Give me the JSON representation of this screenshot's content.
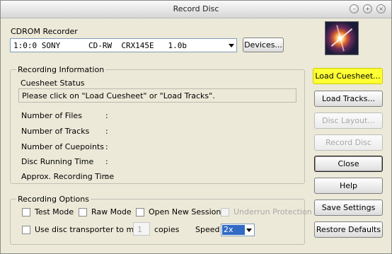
{
  "window": {
    "title": "Record Disc"
  },
  "recorder": {
    "label": "CDROM Recorder",
    "selected": "1:0:0 SONY      CD-RW  CRX145E   1.0b",
    "devices_button": "Devices..."
  },
  "info": {
    "group_label": "Recording Information",
    "cuesheet_status_label": "Cuesheet Status",
    "cuesheet_status_text": "Please click on \"Load Cuesheet\" or \"Load Tracks\".",
    "rows": [
      {
        "label": "Number of Files",
        "value": ":"
      },
      {
        "label": "Number of Tracks",
        "value": ":"
      },
      {
        "label": "Number of Cuepoints",
        "value": ":"
      },
      {
        "label": "Disc Running Time",
        "value": ":"
      },
      {
        "label": "Approx. Recording Time",
        "value": ":"
      }
    ]
  },
  "options": {
    "group_label": "Recording Options",
    "test_mode": "Test Mode",
    "raw_mode": "Raw Mode",
    "open_new_session": "Open New Session",
    "underrun_protection": "Underrun Protection",
    "transporter_label": "Use disc transporter to make",
    "copies_value": "1",
    "copies_label": "copies",
    "speed_label": "Speed",
    "speed_value": "2x"
  },
  "side_buttons": {
    "load_cuesheet": "Load Cuesheet...",
    "load_tracks": "Load Tracks...",
    "disc_layout": "Disc Layout...",
    "record_disc": "Record Disc",
    "close": "Close",
    "help": "Help",
    "save_settings": "Save Settings",
    "restore_defaults": "Restore Defaults"
  },
  "icons": {
    "title_minimize": "minimize-icon",
    "title_maximize": "maximize-icon",
    "title_close": "close-icon",
    "logo": "disc-logo-icon"
  },
  "colors": {
    "highlight": "#ffff33",
    "selection": "#316ac5",
    "window_bg": "#ece9d8"
  }
}
